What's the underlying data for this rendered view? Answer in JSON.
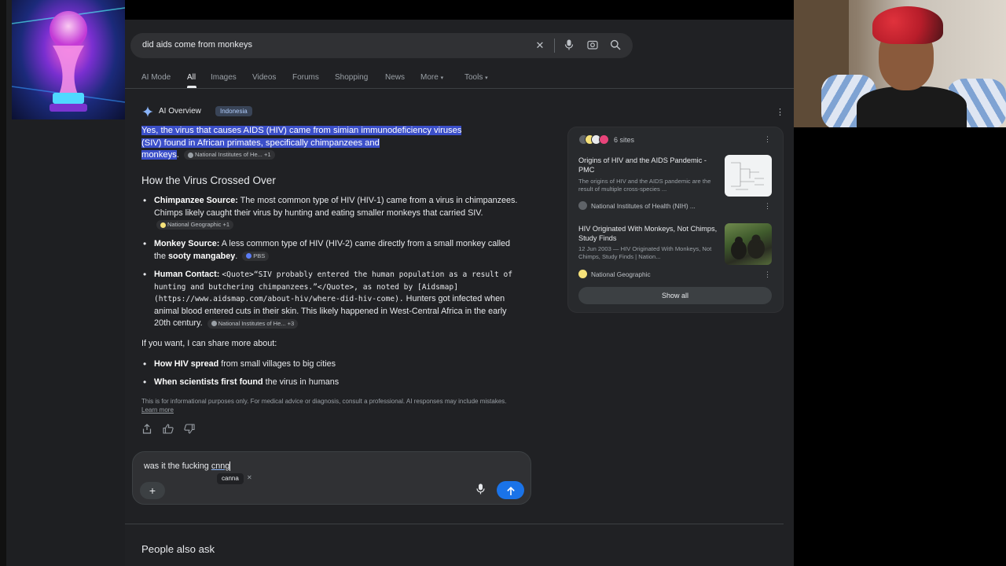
{
  "search": {
    "query": "did aids come from monkeys",
    "icons": [
      "close-icon",
      "mic-icon",
      "lens-icon",
      "search-icon"
    ]
  },
  "tabs": [
    {
      "label": "AI Mode"
    },
    {
      "label": "All",
      "active": true
    },
    {
      "label": "Images"
    },
    {
      "label": "Videos"
    },
    {
      "label": "Forums"
    },
    {
      "label": "Shopping"
    },
    {
      "label": "News"
    },
    {
      "label": "More"
    },
    {
      "label": "Tools"
    }
  ],
  "ai_overview": {
    "title": "AI Overview",
    "chip": "Indonesia",
    "answer_line1": "Yes, the virus that causes AIDS (HIV) came from simian immunodeficiency viruses",
    "answer_line2": "(SIV) found in African primates, specifically chimpanzees and",
    "answer_line3": "monkeys",
    "answer_cite": "National Institutes of He...  +1",
    "heading": "How the Virus Crossed Over",
    "bullets": {
      "b1_bold": "Chimpanzee Source:",
      "b1_text": " The most common type of HIV (HIV-1) came from a virus in chimpanzees. Chimps likely caught their virus by hunting and eating smaller monkeys that carried SIV.",
      "b1_cite": "National Geographic +1",
      "b2_bold": "Monkey Source:",
      "b2_text": " A less common type of HIV (HIV-2) came directly from a small monkey called the ",
      "b2_bold2": "sooty mangabey",
      "b2_end": ".",
      "b2_cite": "PBS",
      "b3_bold": "Human Contact:",
      "b3_mono": "<Quote>“SIV probably entered the human population as a result of hunting and butchering chimpanzees.”</Quote>, as noted by [Aidsmap](https://www.aidsmap.com/about-hiv/where-did-hiv-come).",
      "b3_text": " Hunters got infected when animal blood entered cuts in their skin. This likely happened in West-Central Africa in the early 20th century.",
      "b3_cite": "National Institutes of He...  +3"
    },
    "if_want": "If you want, I can share more about:",
    "more1_bold": "How HIV spread",
    "more1_text": " from small villages to big cities",
    "more2_bold": "When scientists first found",
    "more2_text": " the virus in humans",
    "disclaimer": "This is for informational purposes only. For medical advice or diagnosis, consult a professional. AI responses may include mistakes. ",
    "learn_more": "Learn more"
  },
  "followup": {
    "text": "was it the fucking ",
    "misspelled": "cnng",
    "suggestion": "canna"
  },
  "sources": {
    "count_label": "6 sites",
    "items": [
      {
        "title": "Origins of HIV and the AIDS Pandemic - PMC",
        "snippet": "The origins of HIV and the AIDS pandemic are the result of multiple cross-species ...",
        "site": "National Institutes of Health (NIH) ..."
      },
      {
        "title": "HIV Originated With Monkeys, Not Chimps, Study Finds",
        "snippet": "12 Jun 2003 — HIV Originated With Monkeys, Not Chimps, Study Finds | Nation...",
        "site": "National Geographic"
      }
    ],
    "show_all": "Show all"
  },
  "people_also_ask": "People also ask"
}
